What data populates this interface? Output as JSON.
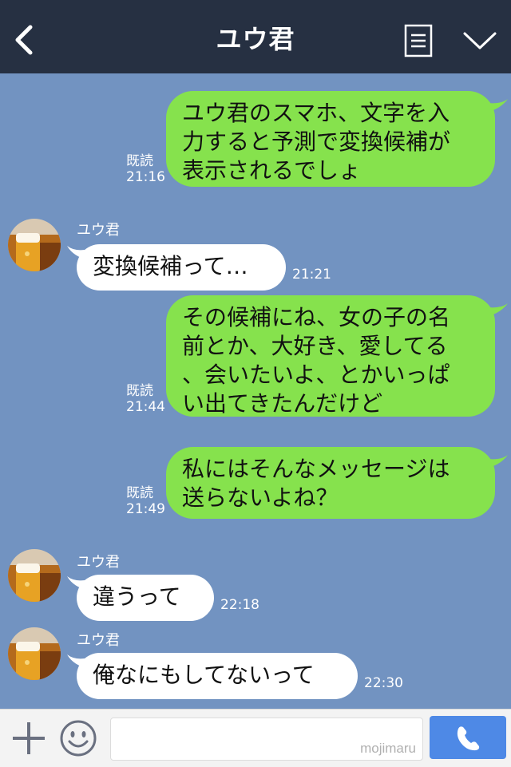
{
  "header": {
    "title": "ユウ君",
    "back_icon": "chevron-left-icon",
    "menu_icon": "menu-icon",
    "collapse_icon": "chevron-down-icon"
  },
  "messages": [
    {
      "side": "out",
      "text": "ユウ君のスマホ、文字を入\n力すると予測で変換候補が\n表示されるでしょ",
      "read": "既読",
      "time": "21:16"
    },
    {
      "side": "in",
      "sender": "ユウ君",
      "text": "変換候補って…",
      "time": "21:21"
    },
    {
      "side": "out",
      "text": "その候補にね、女の子の名\n前とか、大好き、愛してる\n、会いたいよ、とかいっぱ\nい出てきたんだけど",
      "read": "既読",
      "time": "21:44"
    },
    {
      "side": "out",
      "text": "私にはそんなメッセージは\n送らないよね？",
      "read": "既読",
      "time": "21:49"
    },
    {
      "side": "in",
      "sender": "ユウ君",
      "text": "違うって",
      "time": "22:18"
    },
    {
      "side": "in",
      "sender": "ユウ君",
      "text": "俺なにもしてないって",
      "time": "22:30"
    }
  ],
  "footer": {
    "input_value": "",
    "watermark": "mojimaru",
    "plus_icon": "plus-icon",
    "sticker_icon": "smile-icon",
    "call_icon": "phone-icon"
  },
  "colors": {
    "background": "#7293c1",
    "header": "#263042",
    "outgoing_bubble": "#86e24d",
    "incoming_bubble": "#ffffff",
    "call_button": "#4e89e6"
  }
}
